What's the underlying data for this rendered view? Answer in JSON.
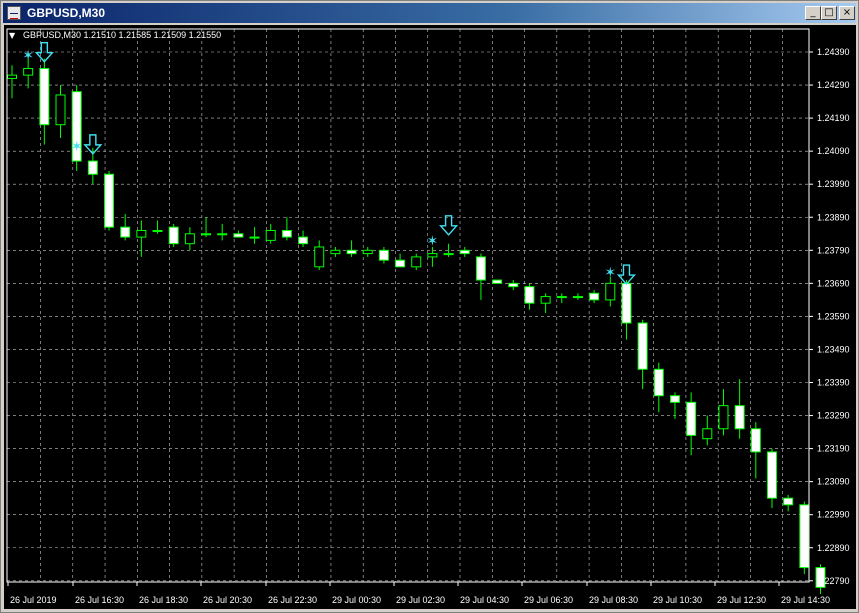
{
  "window": {
    "title": "GBPUSD,M30",
    "minimize_glyph": "_",
    "maximize_glyph": "□",
    "close_glyph": "×"
  },
  "chart_header": {
    "menu_glyph": "▼",
    "text": "GBPUSD,M30  1.21510 1.21585 1.21509 1.21550"
  },
  "chart_data": {
    "type": "candlestick",
    "symbol": "GBPUSD",
    "timeframe": "M30",
    "ylim": [
      1.2275,
      1.2446
    ],
    "y_ticks": [
      "1.24390",
      "1.24290",
      "1.24190",
      "1.24090",
      "1.23990",
      "1.23890",
      "1.23790",
      "1.23690",
      "1.23590",
      "1.23490",
      "1.23390",
      "1.23290",
      "1.23190",
      "1.23090",
      "1.22990",
      "1.22890",
      "1.22790"
    ],
    "x_tick_labels": [
      "26 Jul 2019",
      "26 Jul 16:30",
      "26 Jul 18:30",
      "26 Jul 20:30",
      "26 Jul 22:30",
      "29 Jul 00:30",
      "29 Jul 02:30",
      "29 Jul 04:30",
      "29 Jul 06:30",
      "29 Jul 08:30",
      "29 Jul 10:30",
      "29 Jul 12:30",
      "29 Jul 14:30"
    ],
    "grid": true,
    "colors": {
      "background": "#000000",
      "grid": "#c8c8c8",
      "bull_body": "#000000",
      "bear_body": "#ffffff",
      "wick": "#00ff00",
      "signal": "#40e0f0",
      "axis_text": "#ffffff"
    },
    "candles": [
      {
        "o": 1.2431,
        "h": 1.2435,
        "l": 1.2425,
        "c": 1.2432
      },
      {
        "o": 1.2432,
        "h": 1.2437,
        "l": 1.2428,
        "c": 1.2434
      },
      {
        "o": 1.2434,
        "h": 1.2437,
        "l": 1.2411,
        "c": 1.2417
      },
      {
        "o": 1.2417,
        "h": 1.2429,
        "l": 1.2413,
        "c": 1.2426
      },
      {
        "o": 1.2427,
        "h": 1.2429,
        "l": 1.2403,
        "c": 1.2406
      },
      {
        "o": 1.2406,
        "h": 1.241,
        "l": 1.2399,
        "c": 1.2402
      },
      {
        "o": 1.2402,
        "h": 1.2403,
        "l": 1.2385,
        "c": 1.2386
      },
      {
        "o": 1.2386,
        "h": 1.239,
        "l": 1.2382,
        "c": 1.2383
      },
      {
        "o": 1.2383,
        "h": 1.2388,
        "l": 1.2377,
        "c": 1.2385
      },
      {
        "o": 1.2385,
        "h": 1.2388,
        "l": 1.2384,
        "c": 1.2385
      },
      {
        "o": 1.2386,
        "h": 1.2387,
        "l": 1.238,
        "c": 1.2381
      },
      {
        "o": 1.2381,
        "h": 1.2386,
        "l": 1.2379,
        "c": 1.2384
      },
      {
        "o": 1.2384,
        "h": 1.2389,
        "l": 1.2383,
        "c": 1.2384
      },
      {
        "o": 1.2384,
        "h": 1.2387,
        "l": 1.2382,
        "c": 1.2384
      },
      {
        "o": 1.2384,
        "h": 1.2385,
        "l": 1.2383,
        "c": 1.2383
      },
      {
        "o": 1.2383,
        "h": 1.2386,
        "l": 1.2381,
        "c": 1.2383
      },
      {
        "o": 1.2382,
        "h": 1.2387,
        "l": 1.2381,
        "c": 1.2385
      },
      {
        "o": 1.2385,
        "h": 1.2389,
        "l": 1.2382,
        "c": 1.2383
      },
      {
        "o": 1.2383,
        "h": 1.2385,
        "l": 1.238,
        "c": 1.2381
      },
      {
        "o": 1.2374,
        "h": 1.2382,
        "l": 1.2373,
        "c": 1.238
      },
      {
        "o": 1.2378,
        "h": 1.238,
        "l": 1.2377,
        "c": 1.2379
      },
      {
        "o": 1.2379,
        "h": 1.2382,
        "l": 1.2377,
        "c": 1.2378
      },
      {
        "o": 1.2378,
        "h": 1.238,
        "l": 1.2377,
        "c": 1.2379
      },
      {
        "o": 1.2379,
        "h": 1.238,
        "l": 1.2375,
        "c": 1.2376
      },
      {
        "o": 1.2376,
        "h": 1.2378,
        "l": 1.2374,
        "c": 1.2374
      },
      {
        "o": 1.2374,
        "h": 1.2378,
        "l": 1.2373,
        "c": 1.2377
      },
      {
        "o": 1.2377,
        "h": 1.238,
        "l": 1.2374,
        "c": 1.2378
      },
      {
        "o": 1.2378,
        "h": 1.2381,
        "l": 1.2377,
        "c": 1.2378
      },
      {
        "o": 1.2379,
        "h": 1.238,
        "l": 1.2377,
        "c": 1.2378
      },
      {
        "o": 1.2377,
        "h": 1.2378,
        "l": 1.2364,
        "c": 1.237
      },
      {
        "o": 1.237,
        "h": 1.237,
        "l": 1.2369,
        "c": 1.2369
      },
      {
        "o": 1.2369,
        "h": 1.237,
        "l": 1.2367,
        "c": 1.2368
      },
      {
        "o": 1.2368,
        "h": 1.2369,
        "l": 1.2361,
        "c": 1.2363
      },
      {
        "o": 1.2363,
        "h": 1.2366,
        "l": 1.236,
        "c": 1.2365
      },
      {
        "o": 1.2365,
        "h": 1.2366,
        "l": 1.2363,
        "c": 1.2365
      },
      {
        "o": 1.2365,
        "h": 1.2366,
        "l": 1.2364,
        "c": 1.2365
      },
      {
        "o": 1.2366,
        "h": 1.2367,
        "l": 1.2363,
        "c": 1.2364
      },
      {
        "o": 1.2364,
        "h": 1.2371,
        "l": 1.2362,
        "c": 1.2369
      },
      {
        "o": 1.2369,
        "h": 1.237,
        "l": 1.2352,
        "c": 1.2357
      },
      {
        "o": 1.2357,
        "h": 1.2358,
        "l": 1.2337,
        "c": 1.2343
      },
      {
        "o": 1.2343,
        "h": 1.2345,
        "l": 1.233,
        "c": 1.2335
      },
      {
        "o": 1.2335,
        "h": 1.2336,
        "l": 1.2328,
        "c": 1.2333
      },
      {
        "o": 1.2333,
        "h": 1.2336,
        "l": 1.2317,
        "c": 1.2323
      },
      {
        "o": 1.2322,
        "h": 1.2329,
        "l": 1.232,
        "c": 1.2325
      },
      {
        "o": 1.2325,
        "h": 1.2337,
        "l": 1.2323,
        "c": 1.2332
      },
      {
        "o": 1.2332,
        "h": 1.234,
        "l": 1.2322,
        "c": 1.2325
      },
      {
        "o": 1.2325,
        "h": 1.2327,
        "l": 1.231,
        "c": 1.2318
      },
      {
        "o": 1.2318,
        "h": 1.2319,
        "l": 1.2301,
        "c": 1.2304
      },
      {
        "o": 1.2304,
        "h": 1.2305,
        "l": 1.23,
        "c": 1.2302
      },
      {
        "o": 1.2302,
        "h": 1.2303,
        "l": 1.2281,
        "c": 1.2283
      },
      {
        "o": 1.2283,
        "h": 1.2284,
        "l": 1.2275,
        "c": 1.2277
      }
    ],
    "signals": [
      {
        "type": "star",
        "index": 1,
        "price": 1.24378
      },
      {
        "type": "arrow-down",
        "index": 2,
        "price": 1.24388
      },
      {
        "type": "star",
        "index": 4,
        "price": 1.24103
      },
      {
        "type": "arrow-down",
        "index": 5,
        "price": 1.24109
      },
      {
        "type": "star",
        "index": 26,
        "price": 1.23816
      },
      {
        "type": "arrow-down",
        "index": 27,
        "price": 1.23864
      },
      {
        "type": "star",
        "index": 37,
        "price": 1.23721
      },
      {
        "type": "arrow-down",
        "index": 38,
        "price": 1.23715
      }
    ]
  }
}
